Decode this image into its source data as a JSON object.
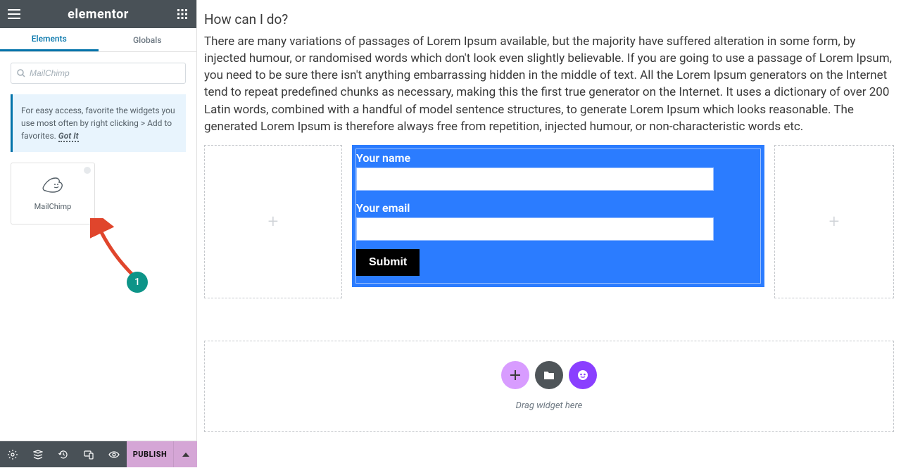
{
  "header": {
    "logo": "elementor"
  },
  "tabs": {
    "elements": "Elements",
    "globals": "Globals"
  },
  "search": {
    "value": "MailChimp"
  },
  "tip": {
    "text": "For easy access, favorite the widgets you use most often by right clicking > Add to favorites.",
    "gotit": "Got It"
  },
  "widgets": [
    {
      "label": "MailChimp"
    }
  ],
  "footer": {
    "publish": "PUBLISH"
  },
  "content": {
    "heading": "How can I do?",
    "para": "There are many variations of passages of Lorem Ipsum available, but the majority have suffered alteration in some form, by injected humour, or randomised words which don't look even slightly believable. If you are going to use a passage of Lorem Ipsum, you need to be sure there isn't anything embarrassing hidden in the middle of text. All the Lorem Ipsum generators on the Internet tend to repeat predefined chunks as necessary, making this the first true generator on the Internet. It uses a dictionary of over 200 Latin words, combined with a handful of model sentence structures, to generate Lorem Ipsum which looks reasonable. The generated Lorem Ipsum is therefore always free from repetition, injected humour, or non-characteristic words etc."
  },
  "form": {
    "name_label": "Your name",
    "email_label": "Your email",
    "submit": "Submit"
  },
  "dropzone": {
    "text": "Drag widget here"
  },
  "annotation": {
    "badge": "1"
  }
}
